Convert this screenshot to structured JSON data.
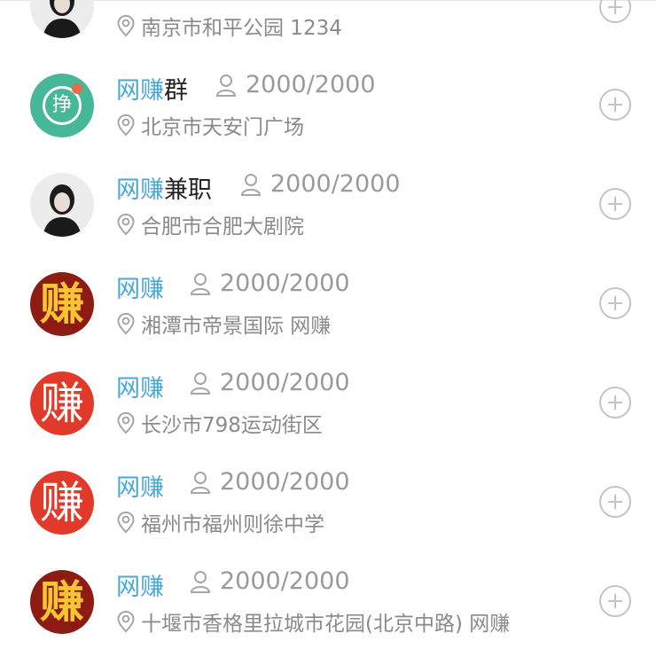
{
  "groups": [
    {
      "name_highlight": "",
      "name_rest": "",
      "members": "",
      "location": "南京市和平公园  1234",
      "avatar": "photo"
    },
    {
      "name_highlight": "网赚",
      "name_rest": "群",
      "members": "2000/2000",
      "location": "北京市天安门广场",
      "avatar": "green-zheng",
      "avatar_text": "挣"
    },
    {
      "name_highlight": "网赚",
      "name_rest": "兼职",
      "members": "2000/2000",
      "location": "合肥市合肥大剧院",
      "avatar": "photo"
    },
    {
      "name_highlight": "网赚",
      "name_rest": "",
      "members": "2000/2000",
      "location": "湘潭市帝景国际  网赚",
      "avatar": "darkred-zhuan",
      "avatar_text": "赚"
    },
    {
      "name_highlight": "网赚",
      "name_rest": "",
      "members": "2000/2000",
      "location": "长沙市798运动街区",
      "avatar": "red-zhuan",
      "avatar_text": "赚"
    },
    {
      "name_highlight": "网赚",
      "name_rest": "",
      "members": "2000/2000",
      "location": "福州市福州则徐中学",
      "avatar": "red-zhuan",
      "avatar_text": "赚"
    },
    {
      "name_highlight": "网赚",
      "name_rest": "",
      "members": "2000/2000",
      "location": "十堰市香格里拉城市花园(北京中路)  网赚",
      "avatar": "darkred-zhuan",
      "avatar_text": "赚"
    }
  ],
  "colors": {
    "highlight": "#48a8d8",
    "muted": "#9a9a9a",
    "icon": "#c4c4c4"
  },
  "icons": {
    "member": "person-icon",
    "location": "location-pin-icon",
    "add": "add-circle-icon"
  }
}
